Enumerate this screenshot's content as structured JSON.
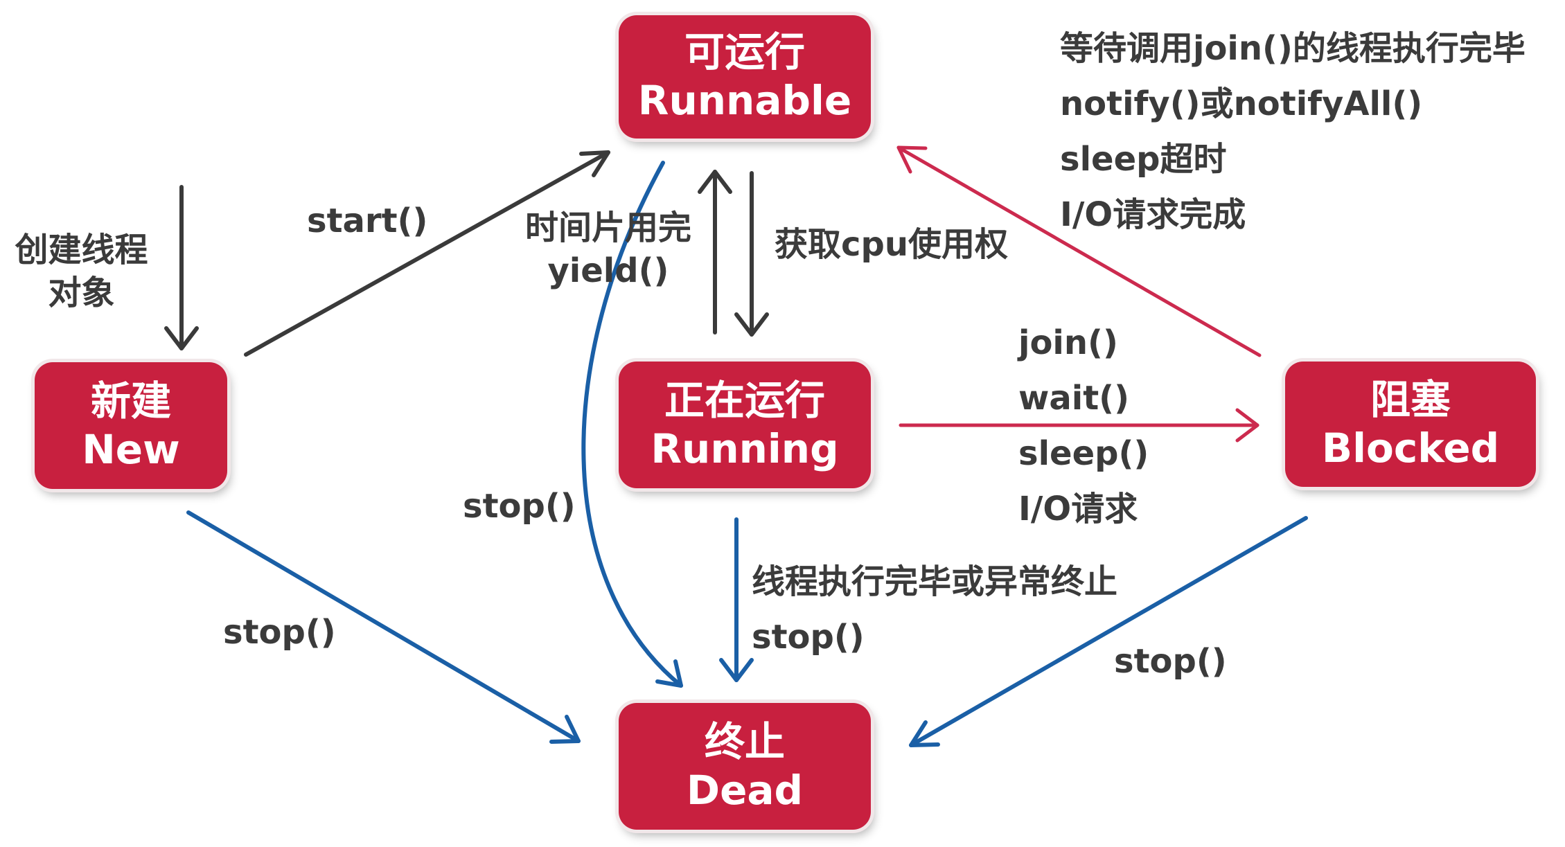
{
  "colors": {
    "node_fill": "#c8203f",
    "dark_arrow": "#3a3a3a",
    "red_arrow": "#cc2a4e",
    "blue_arrow": "#1a5fa6",
    "label_text": "#3b3b3b"
  },
  "nodes": {
    "runnable": {
      "cn": "可运行",
      "en": "Runnable"
    },
    "new": {
      "cn": "新建",
      "en": "New"
    },
    "running": {
      "cn": "正在运行",
      "en": "Running"
    },
    "blocked": {
      "cn": "阻塞",
      "en": "Blocked"
    },
    "dead": {
      "cn": "终止",
      "en": "Dead"
    }
  },
  "labels": {
    "create_object": [
      "创建线程",
      "对象"
    ],
    "start": "start()",
    "time_slice": [
      "时间片用完",
      "yield()"
    ],
    "get_cpu": "获取cpu使用权",
    "unblock": [
      "等待调用join()的线程执行完毕",
      "notify()或notifyAll()",
      "sleep超时",
      "I/O请求完成"
    ],
    "block": [
      "join()",
      "wait()",
      "sleep()",
      "I/O请求"
    ],
    "runnable_stop": "stop()",
    "new_stop": "stop()",
    "finish": [
      "线程执行完毕或异常终止",
      "stop()"
    ],
    "blocked_stop": "stop()"
  }
}
